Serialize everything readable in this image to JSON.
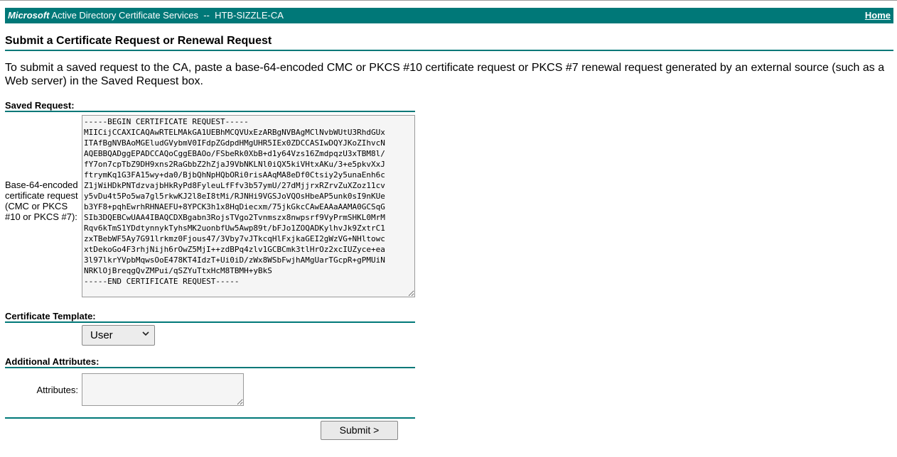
{
  "header": {
    "brand": "Microsoft",
    "title": " Active Directory Certificate Services  --  HTB-SIZZLE-CA",
    "home_link": "Home",
    "bar_color": "#007878"
  },
  "page_title": "Submit a Certificate Request or Renewal Request",
  "intro": "To submit a saved request to the CA, paste a base-64-encoded CMC or PKCS #10 certificate request or PKCS #7 renewal request generated by an external source (such as a Web server) in the Saved Request box.",
  "saved_request": {
    "section_label": "Saved Request:",
    "field_label": "Base-64-encoded certificate request (CMC or PKCS #10 or PKCS #7):",
    "value": "-----BEGIN CERTIFICATE REQUEST-----\nMIICijCCAXICAQAwRTELMAkGA1UEBhMCQVUxEzARBgNVBAgMClNvbWUtU3RhdGUx\nITAfBgNVBAoMGEludGVybmV0IFdpZGdpdHMgUHR5IEx0ZDCCASIwDQYJKoZIhvcN\nAQEBBQADggEPADCCAQoCggEBAOo/FSbeRk0XbB+d1y64Vzs16ZmdpqzU3xTBM8l/\nfY7on7cpTbZ9DH9xns2RaGbbZ2hZjaJ9VbNKLNl0iQX5kiVHtxAKu/3+e5pkvXxJ\nftrymKq1G3FA15wy+da0/BjbQhNpHQbORi0risAAqMA8eDf0Ctsiy2y5unaEnh6c\nZ1jWiHDkPNTdzvajbHkRyPd8FyleuLfFfv3b57ymU/27dMjjrxRZrvZuXZoz11cv\ny5vDu4t5Po5wa7gl5rkwKJ2l8eI8tMi/RJNHi9VGSJoVQOsHbeAP5unk0sI9nKUe\nb3YF8+pqhEwrhRHNAEFU+8YPCK3h1x8HqDiecxm/75jkGkcCAwEAAaAAMA0GCSqG\nSIb3DQEBCwUAA4IBAQCDXBgabn3RojsTVgo2Tvnmszx8nwpsrf9VyPrmSHKL0MrM\nRqv6kTmS1YDdtynnykTyhsMK2uonbfUw5Awp89t/bFJo1ZOQADKylhvJk9ZxtrC1\nzxTBebWF5Ay7G91lrkmz0Fjous47/3Vby7vJTkcqHlFxjkaGEI2gWzVG+NHltowc\nxtDekoGo4F3rhjNijh6rOwZ5MjI++zdBPq4zlv1GCBCmk3tlHrOz2xcIUZyce+ea\n3l97lkrYVpbMqwsOoE478KT4IdzT+Ui0iD/zWx8WSbFwjhAMgUarTGcpR+gPMUiN\nNRKlOjBreqgQvZMPui/qSZYuTtxHcM8TBMH+yBkS\n-----END CERTIFICATE REQUEST-----"
  },
  "certificate_template": {
    "section_label": "Certificate Template:",
    "selected": "User"
  },
  "additional_attributes": {
    "section_label": "Additional Attributes:",
    "field_label": "Attributes:",
    "value": ""
  },
  "submit_label": "Submit >"
}
